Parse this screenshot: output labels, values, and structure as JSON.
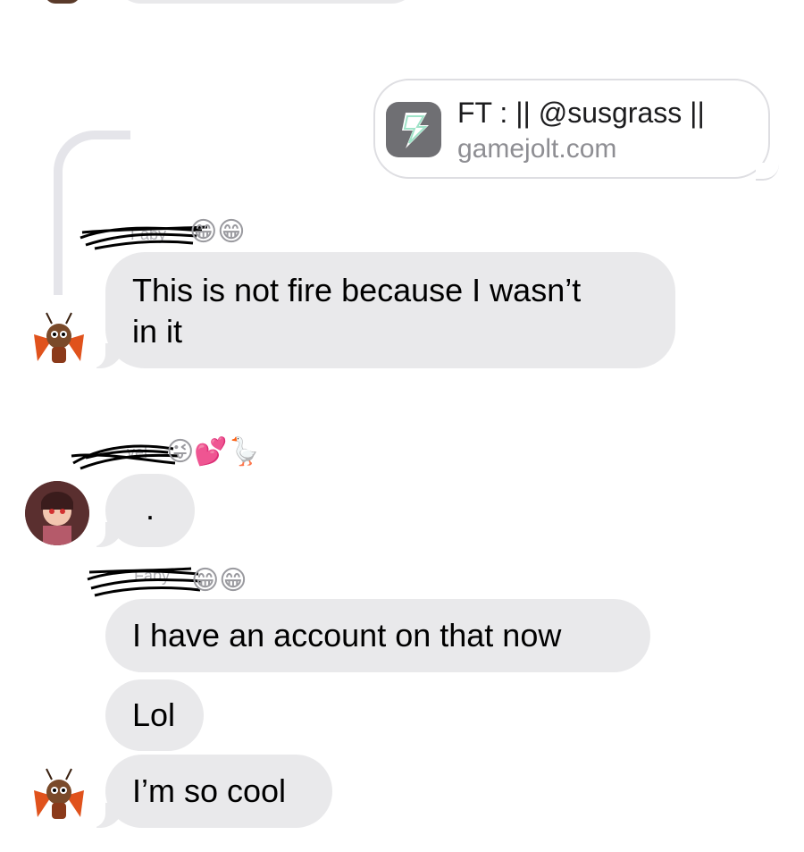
{
  "link_preview": {
    "title": "FT : || @susgrass ||",
    "domain": "gamejolt.com",
    "icon": "gamejolt-lightning-icon"
  },
  "messages": [
    {
      "sender_emojis": "😁😁",
      "text_line1": "This is not fire because I wasn’t",
      "text_line2": "in it"
    },
    {
      "sender_emojis": "😜💕🪿",
      "text": "."
    },
    {
      "sender_emojis": "😁😁",
      "text": "I have an account on that now"
    },
    {
      "text": "Lol"
    },
    {
      "text": "I’m so cool"
    }
  ],
  "colors": {
    "bubble_gray": "#e9e9eb",
    "reply_line": "#e5e5ea",
    "secondary_text": "#8e8e93"
  }
}
